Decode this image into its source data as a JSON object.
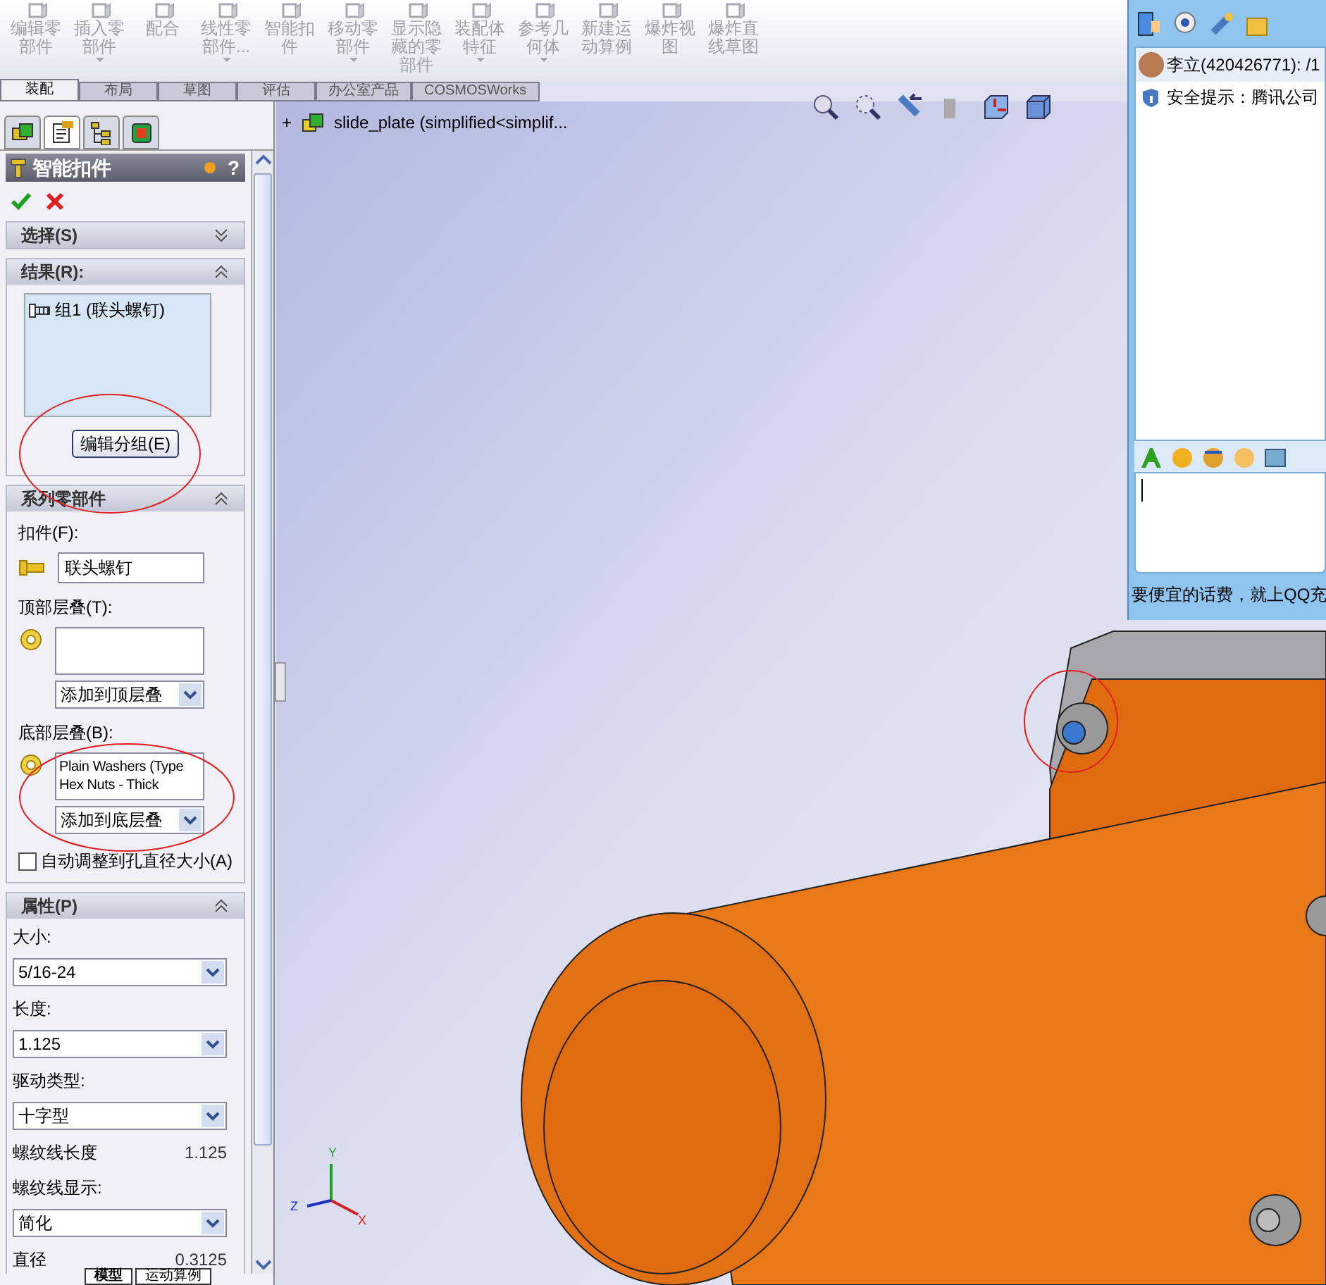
{
  "toolbar": {
    "items": [
      {
        "lines": [
          "编辑零",
          "部件"
        ],
        "has_menu": false,
        "disabled": true
      },
      {
        "lines": [
          "插入零",
          "部件"
        ],
        "has_menu": true,
        "disabled": true
      },
      {
        "lines": [
          "配合"
        ],
        "has_menu": false,
        "disabled": true
      },
      {
        "lines": [
          "线性零",
          "部件..."
        ],
        "has_menu": true,
        "disabled": true
      },
      {
        "lines": [
          "智能扣",
          "件"
        ],
        "has_menu": false,
        "disabled": true
      },
      {
        "lines": [
          "移动零",
          "部件"
        ],
        "has_menu": true,
        "disabled": true
      },
      {
        "lines": [
          "显示隐",
          "藏的零",
          "部件"
        ],
        "has_menu": false,
        "disabled": true
      },
      {
        "lines": [
          "装配体",
          "特征"
        ],
        "has_menu": true,
        "disabled": true
      },
      {
        "lines": [
          "参考几",
          "何体"
        ],
        "has_menu": true,
        "disabled": true
      },
      {
        "lines": [
          "新建运",
          "动算例"
        ],
        "has_menu": false,
        "disabled": true
      },
      {
        "lines": [
          "爆炸视",
          "图"
        ],
        "has_menu": false,
        "disabled": true
      },
      {
        "lines": [
          "爆炸直",
          "线草图"
        ],
        "has_menu": false,
        "disabled": true
      }
    ]
  },
  "tabs": [
    {
      "label": "装配",
      "selected": true
    },
    {
      "label": "布局",
      "selected": false
    },
    {
      "label": "草图",
      "selected": false
    },
    {
      "label": "评估",
      "selected": false
    },
    {
      "label": "办公室产品",
      "selected": false
    },
    {
      "label": "COSMOSWorks",
      "selected": false
    }
  ],
  "panel_tabs": [
    {
      "selected": false
    },
    {
      "selected": true
    },
    {
      "selected": false
    },
    {
      "selected": false
    }
  ],
  "tree": {
    "expander": "+",
    "label": "slide_plate  (simplified<simplif..."
  },
  "property_manager": {
    "title": "智能扣件",
    "help": "?",
    "sections": [
      {
        "kind": "selection",
        "title": "选择(S)",
        "expanded": false
      },
      {
        "kind": "results",
        "title": "结果(R):",
        "expanded": true,
        "items": [
          "组1 (联头螺钉)"
        ],
        "button": "编辑分组(E)"
      },
      {
        "kind": "series",
        "title": "系列零部件",
        "expanded": true,
        "fastener": {
          "label": "扣件(F):",
          "value": "联头螺钉"
        },
        "top_stack": {
          "label": "顶部层叠(T):",
          "dropdown": "添加到顶层叠"
        },
        "bottom_stack": {
          "label": "底部层叠(B):",
          "items": [
            "Plain Washers (Type",
            "Hex Nuts - Thick"
          ],
          "dropdown": "添加到底层叠"
        },
        "auto_size": {
          "label": "自动调整到孔直径大小(A)",
          "checked": false
        }
      },
      {
        "kind": "properties",
        "title": "属性(P)",
        "expanded": true,
        "fields": [
          {
            "kind": "dropdown",
            "label": "大小:",
            "value": "5/16-24"
          },
          {
            "kind": "dropdown",
            "label": "长度:",
            "value": "1.125"
          },
          {
            "kind": "dropdown",
            "label": "驱动类型:",
            "value": "十字型"
          },
          {
            "kind": "readout",
            "label": "螺纹线长度",
            "value": "1.125"
          },
          {
            "kind": "dropdown",
            "label": "螺纹线显示:",
            "value": "简化"
          },
          {
            "kind": "readout",
            "label": "直径",
            "value": "0.3125"
          }
        ]
      }
    ]
  },
  "bottom_tabs": [
    {
      "label": "模型",
      "selected": true
    },
    {
      "label": "运动算例",
      "selected": false
    }
  ],
  "triad": {
    "y": "Y",
    "x": "X",
    "z": "Z"
  },
  "chat_window": {
    "contact": "李立(420426771): /1",
    "notice": "安全提示：腾讯公司",
    "ad": "要便宜的话费，就上QQ充"
  }
}
